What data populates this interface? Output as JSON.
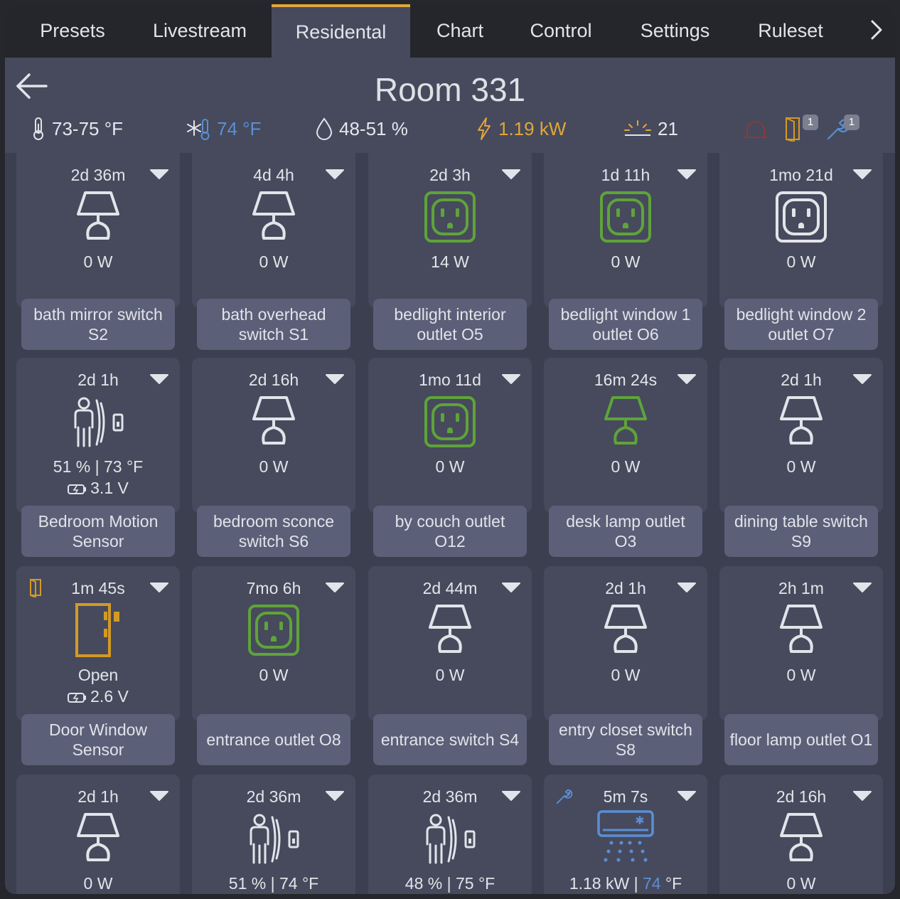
{
  "colors": {
    "accent": "#e2a63a",
    "outlet_on": "#5fa33a",
    "motion_blue": "#5a8fd6",
    "door": "#d49a24"
  },
  "tabs": [
    {
      "label": "Presets"
    },
    {
      "label": "Livestream"
    },
    {
      "label": "Residental"
    },
    {
      "label": "Chart"
    },
    {
      "label": "Control"
    },
    {
      "label": "Settings"
    },
    {
      "label": "Ruleset"
    }
  ],
  "header": {
    "title": "Room 331",
    "temp_range": "73-75 °F",
    "setpoint": "74 °F",
    "humidity": "48-51 %",
    "power": "1.19 kW",
    "light": "21",
    "door_badge": "1",
    "maint_badge": "1"
  },
  "cards": [
    {
      "time": "2d 36m",
      "icon": "lamp-icon",
      "value": "0 W",
      "label": "bath mirror switch S2"
    },
    {
      "time": "4d 4h",
      "icon": "lamp-icon",
      "value": "0 W",
      "label": "bath overhead switch S1"
    },
    {
      "time": "2d 3h",
      "icon": "outlet-on-icon",
      "value": "14 W",
      "label": "bedlight interior outlet O5"
    },
    {
      "time": "1d 11h",
      "icon": "outlet-on-icon",
      "value": "0 W",
      "label": "bedlight window 1 outlet O6"
    },
    {
      "time": "1mo 21d",
      "icon": "outlet-off-icon",
      "value": "0 W",
      "label": "bedlight window 2 outlet O7"
    },
    {
      "time": "2d 1h",
      "icon": "motion-sensor-icon",
      "value": "51 % | 73 °F",
      "volt": "3.1 V",
      "label": "Bedroom Motion Sensor"
    },
    {
      "time": "2d 16h",
      "icon": "lamp-icon",
      "value": "0 W",
      "label": "bedroom sconce switch S6"
    },
    {
      "time": "1mo 11d",
      "icon": "outlet-on-icon",
      "value": "0 W",
      "label": "by couch outlet O12"
    },
    {
      "time": "16m 24s",
      "icon": "lamp-on-icon",
      "value": "0 W",
      "label": "desk lamp outlet O3"
    },
    {
      "time": "2d 1h",
      "icon": "lamp-icon",
      "value": "0 W",
      "label": "dining table switch S9"
    },
    {
      "time": "1m 45s",
      "icon": "door-icon",
      "value": "Open",
      "volt": "2.6 V",
      "label": "Door Window Sensor"
    },
    {
      "time": "7mo 6h",
      "icon": "outlet-on-icon",
      "value": "0 W",
      "label": "entrance outlet O8"
    },
    {
      "time": "2d 44m",
      "icon": "lamp-icon",
      "value": "0 W",
      "label": "entrance switch S4"
    },
    {
      "time": "2d 1h",
      "icon": "lamp-icon",
      "value": "0 W",
      "label": "entry closet switch S8"
    },
    {
      "time": "2h 1m",
      "icon": "lamp-icon",
      "value": "0 W",
      "label": "floor lamp outlet O1"
    },
    {
      "time": "2d 1h",
      "icon": "lamp-icon",
      "value": "0 W",
      "label": ""
    },
    {
      "time": "2d 36m",
      "icon": "motion-sensor-icon",
      "value": "51 % | 74 °F",
      "label": ""
    },
    {
      "time": "2d 36m",
      "icon": "motion-sensor-icon",
      "value": "48 % | 75 °F",
      "label": ""
    },
    {
      "time": "5m 7s",
      "icon": "ac-unit-icon",
      "value_a": "1.18 kW | ",
      "value_b": "74",
      "value_c": " °F",
      "label": ""
    },
    {
      "time": "2d 16h",
      "icon": "lamp-icon",
      "value": "0 W",
      "label": ""
    }
  ]
}
